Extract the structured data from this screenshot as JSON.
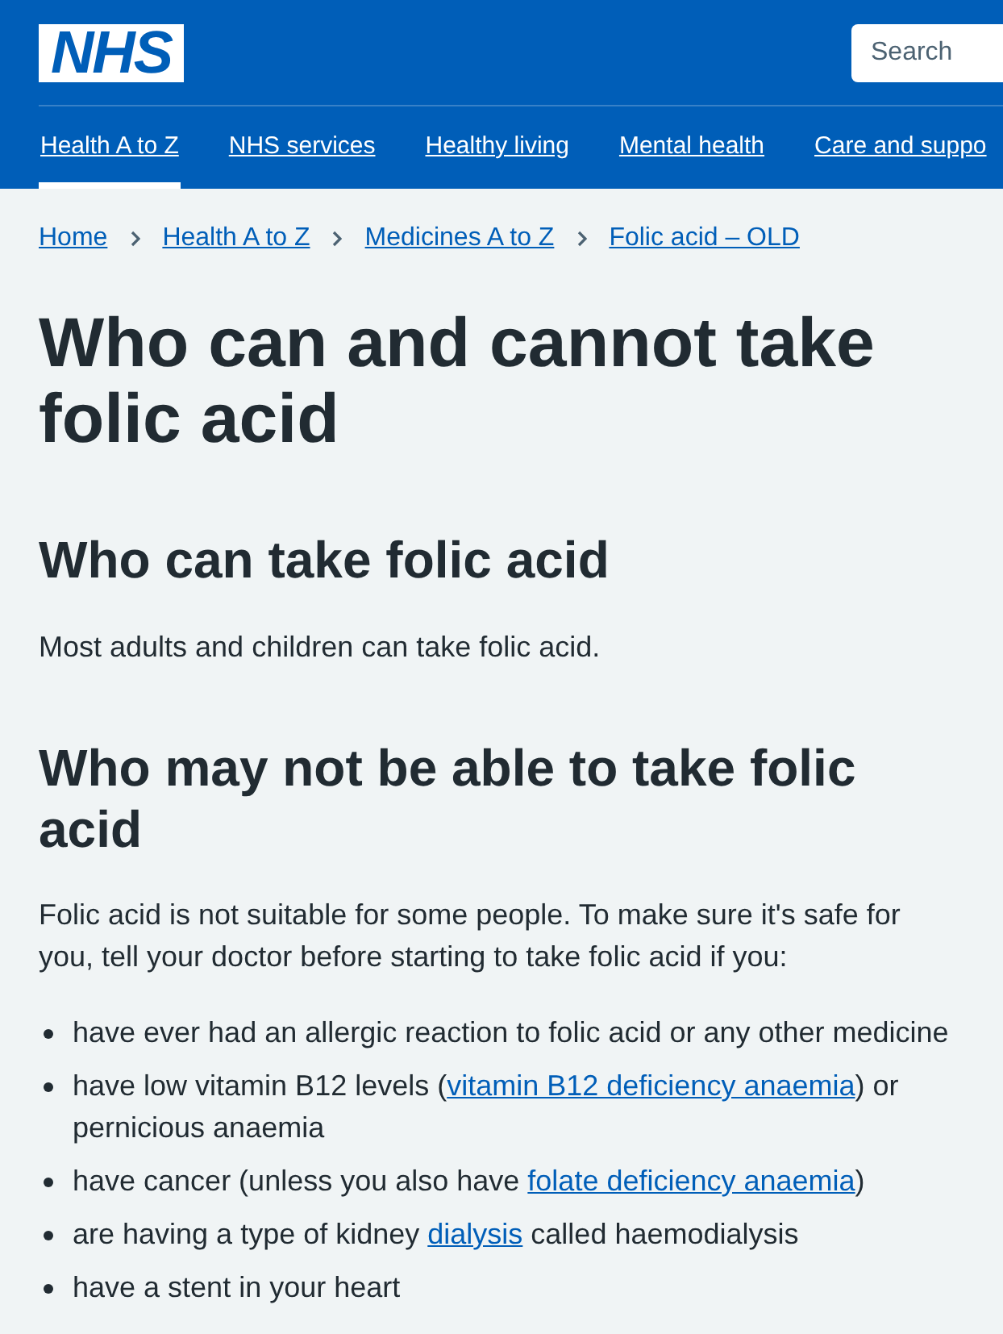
{
  "header": {
    "logo": "NHS",
    "search": {
      "placeholder": "Search"
    }
  },
  "nav": [
    {
      "label": "Health A to Z",
      "selected": true
    },
    {
      "label": "NHS services",
      "selected": false
    },
    {
      "label": "Healthy living",
      "selected": false
    },
    {
      "label": "Mental health",
      "selected": false
    },
    {
      "label": "Care and suppo",
      "selected": false
    }
  ],
  "breadcrumbs": [
    "Home",
    "Health A to Z",
    "Medicines A to Z",
    "Folic acid – OLD"
  ],
  "title": "Who can and cannot take folic acid",
  "sections": [
    {
      "heading": "Who can take folic acid",
      "paragraph": "Most adults and children can take folic acid."
    },
    {
      "heading": "Who may not be able to take folic acid",
      "paragraph": "Folic acid is not suitable for some people. To make sure it's safe for you, tell your doctor before starting to take folic acid if you:",
      "list": [
        {
          "segments": [
            {
              "kind": "text",
              "text": "have ever had an allergic reaction to folic acid or any other medicine"
            }
          ]
        },
        {
          "segments": [
            {
              "kind": "text",
              "text": "have low vitamin B12 levels ("
            },
            {
              "kind": "link",
              "text": "vitamin B12 deficiency anaemia"
            },
            {
              "kind": "text",
              "text": ") or pernicious anaemia"
            }
          ]
        },
        {
          "segments": [
            {
              "kind": "text",
              "text": "have cancer (unless you also have "
            },
            {
              "kind": "link",
              "text": "folate deficiency anaemia"
            },
            {
              "kind": "text",
              "text": ")"
            }
          ]
        },
        {
          "segments": [
            {
              "kind": "text",
              "text": "are having a type of kidney "
            },
            {
              "kind": "link",
              "text": "dialysis"
            },
            {
              "kind": "text",
              "text": " called haemodialysis"
            }
          ]
        },
        {
          "segments": [
            {
              "kind": "text",
              "text": "have a stent in your heart"
            }
          ]
        }
      ]
    }
  ]
}
